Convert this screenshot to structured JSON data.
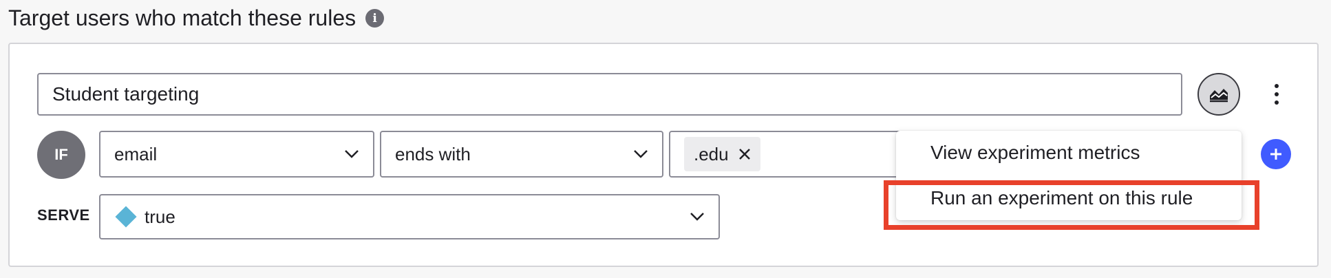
{
  "heading": {
    "title": "Target users who match these rules",
    "info_icon": "i"
  },
  "rule": {
    "name_value": "Student targeting",
    "metrics_icon": "chart-area-icon",
    "menu_icon": "kebab-menu-icon",
    "if_label": "IF",
    "attribute": "email",
    "operator": "ends with",
    "values": [
      ".edu"
    ],
    "serve_label": "SERVE",
    "serve_value": "true",
    "serve_variation_color": "#5ab4d6"
  },
  "menu": {
    "items": [
      "View experiment metrics",
      "Run an experiment on this rule"
    ],
    "highlighted_item": "Run an experiment on this rule",
    "highlight_color": "#e8412b"
  },
  "colors": {
    "add_button": "#405bff",
    "if_badge": "#6f6f76"
  }
}
